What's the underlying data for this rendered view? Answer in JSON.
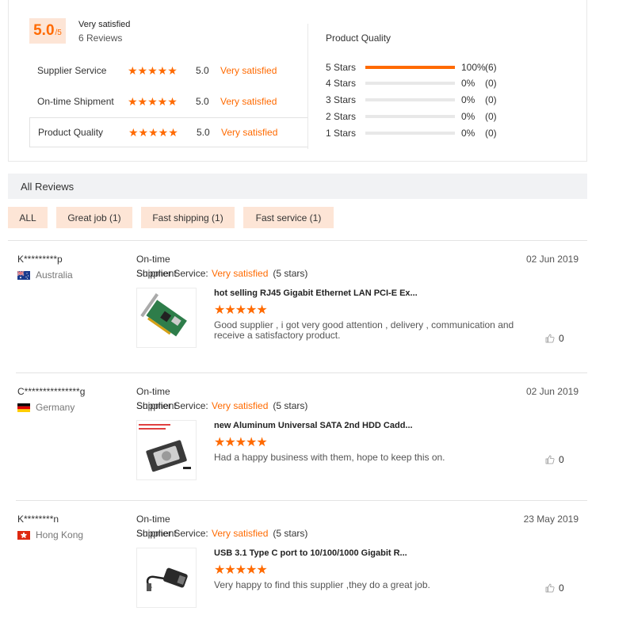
{
  "summary": {
    "overall_score": "5.0",
    "overall_denominator": "/5",
    "overall_text": "Very satisfied",
    "review_count": "6 Reviews",
    "metrics": [
      {
        "label": "Supplier Service",
        "stars": "★★★★★",
        "score": "5.0",
        "status": "Very satisfied"
      },
      {
        "label": "On-time Shipment",
        "stars": "★★★★★",
        "score": "5.0",
        "status": "Very satisfied"
      },
      {
        "label": "Product Quality",
        "stars": "★★★★★",
        "score": "5.0",
        "status": "Very satisfied"
      }
    ],
    "distribution_title": "Product Quality",
    "distribution": [
      {
        "label": "5 Stars",
        "fraction": 1.0,
        "pct": "100%",
        "count": "(6)"
      },
      {
        "label": "4 Stars",
        "fraction": 0.0,
        "pct": "0%",
        "count": "(0)"
      },
      {
        "label": "3 Stars",
        "fraction": 0.0,
        "pct": "0%",
        "count": "(0)"
      },
      {
        "label": "2 Stars",
        "fraction": 0.0,
        "pct": "0%",
        "count": "(0)"
      },
      {
        "label": "1 Stars",
        "fraction": 0.0,
        "pct": "0%",
        "count": "(0)"
      }
    ]
  },
  "all_reviews": {
    "title": "All Reviews",
    "filters": [
      "ALL",
      "Great job (1)",
      "Fast shipping (1)",
      "Fast service (1)"
    ]
  },
  "reviews": [
    {
      "name": "K*********p",
      "country": "Australia",
      "ontime_label": "On-time",
      "overlap_a": "Shipment",
      "overlap_b": "Supplier Service:",
      "status": "Very satisfied",
      "stars_text": "(5 stars)",
      "date": "02 Jun 2019",
      "product_title": "hot selling RJ45 Gigabit Ethernet LAN PCI-E Ex...",
      "product_stars": "★★★★★",
      "text": "Good supplier , i got very good attention , delivery , communication and receive a satisfactory product.",
      "likes": "0"
    },
    {
      "name": "C***************g",
      "country": "Germany",
      "ontime_label": "On-time",
      "overlap_a": "Shipment",
      "overlap_b": "Supplier Service:",
      "status": "Very satisfied",
      "stars_text": "(5 stars)",
      "date": "02 Jun 2019",
      "product_title": "new Aluminum Universal SATA 2nd HDD Cadd...",
      "product_stars": "★★★★★",
      "text": "Had a happy business with them, hope to keep this on.",
      "likes": "0"
    },
    {
      "name": "K********n",
      "country": "Hong Kong",
      "ontime_label": "On-time",
      "overlap_a": "Shipment",
      "overlap_b": "Supplier Service:",
      "status": "Very satisfied",
      "stars_text": "(5 stars)",
      "date": "23 May 2019",
      "product_title": "USB 3.1 Type C port to 10/100/1000 Gigabit R...",
      "product_stars": "★★★★★",
      "text": "Very happy to find this supplier ,they do a great job.",
      "likes": "0"
    }
  ],
  "colors": {
    "accent": "#ff6a00",
    "accent_bg": "#fde5d6"
  },
  "icons": {
    "like": "thumbs-up-icon"
  }
}
